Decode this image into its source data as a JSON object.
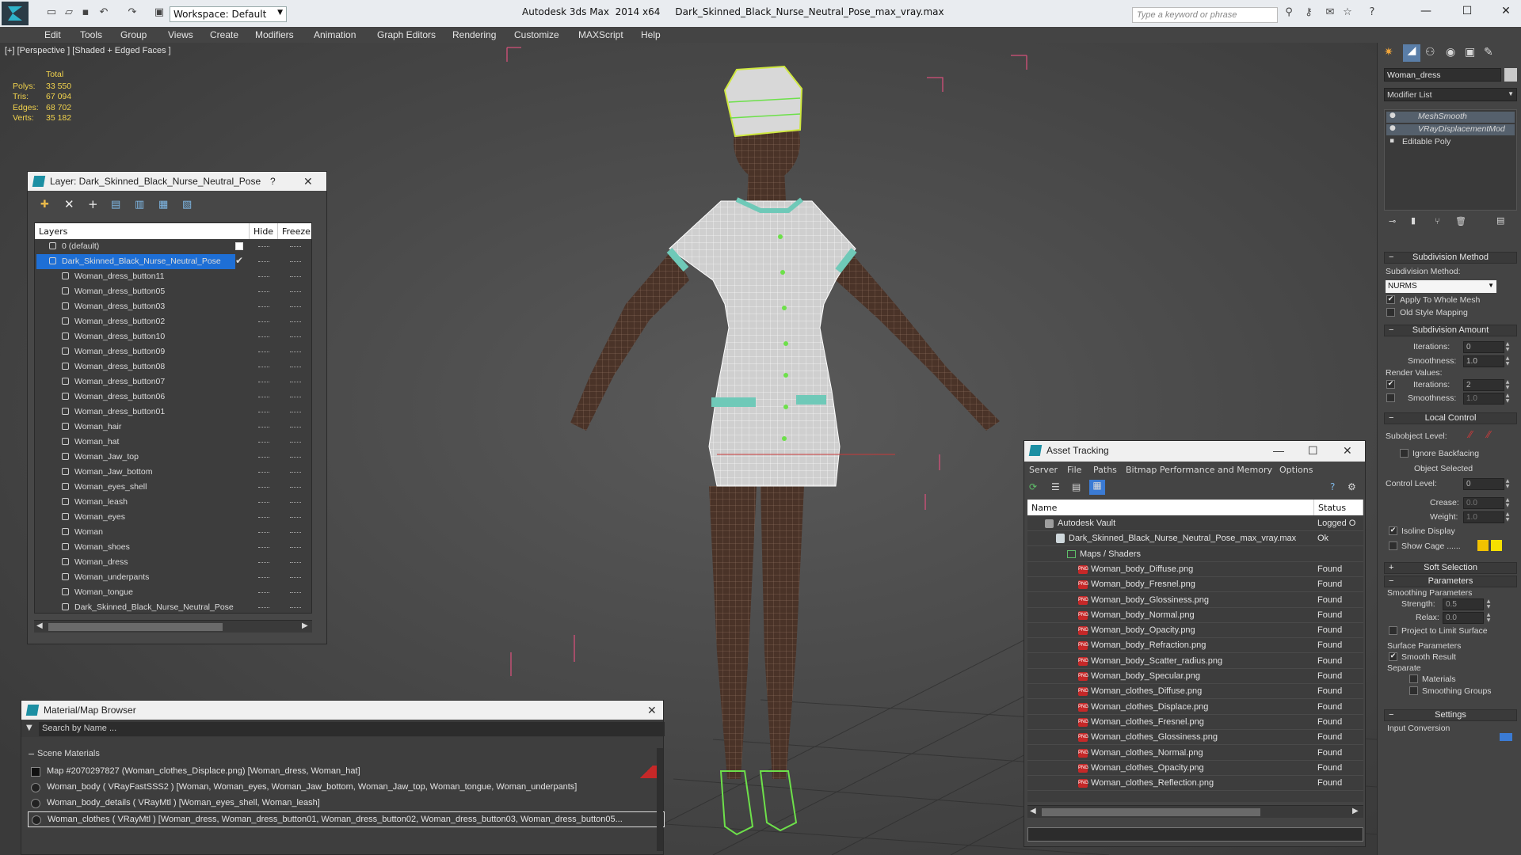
{
  "app": {
    "title": "Autodesk 3ds Max  2014 x64     Dark_Skinned_Black_Nurse_Neutral_Pose_max_vray.max",
    "workspace": "Workspace: Default",
    "search_placeholder": "Type a keyword or phrase"
  },
  "menu": [
    "Edit",
    "Tools",
    "Group",
    "Views",
    "Create",
    "Modifiers",
    "Animation",
    "Graph Editors",
    "Rendering",
    "Customize",
    "MAXScript",
    "Help"
  ],
  "viewport": {
    "label": "[+] [Perspective ] [Shaded + Edged Faces ]",
    "stats": {
      "total_label": "Total",
      "rows": [
        {
          "label": "Polys:",
          "value": "33 550"
        },
        {
          "label": "Tris:",
          "value": "67 094"
        },
        {
          "label": "Edges:",
          "value": "68 702"
        },
        {
          "label": "Verts:",
          "value": "35 182"
        }
      ]
    }
  },
  "layer_explorer": {
    "title": "Layer: Dark_Skinned_Black_Nurse_Neutral_Pose",
    "help": "?",
    "columns": {
      "layers": "Layers",
      "hide": "Hide",
      "freeze": "Freeze"
    },
    "rows": [
      {
        "name": "0 (default)",
        "level": 0,
        "selected": false
      },
      {
        "name": "Dark_Skinned_Black_Nurse_Neutral_Pose",
        "level": 0,
        "selected": true
      },
      {
        "name": "Woman_dress_button11",
        "level": 1,
        "selected": false
      },
      {
        "name": "Woman_dress_button05",
        "level": 1,
        "selected": false
      },
      {
        "name": "Woman_dress_button03",
        "level": 1,
        "selected": false
      },
      {
        "name": "Woman_dress_button02",
        "level": 1,
        "selected": false
      },
      {
        "name": "Woman_dress_button10",
        "level": 1,
        "selected": false
      },
      {
        "name": "Woman_dress_button09",
        "level": 1,
        "selected": false
      },
      {
        "name": "Woman_dress_button08",
        "level": 1,
        "selected": false
      },
      {
        "name": "Woman_dress_button07",
        "level": 1,
        "selected": false
      },
      {
        "name": "Woman_dress_button06",
        "level": 1,
        "selected": false
      },
      {
        "name": "Woman_dress_button01",
        "level": 1,
        "selected": false
      },
      {
        "name": "Woman_hair",
        "level": 1,
        "selected": false
      },
      {
        "name": "Woman_hat",
        "level": 1,
        "selected": false
      },
      {
        "name": "Woman_Jaw_top",
        "level": 1,
        "selected": false
      },
      {
        "name": "Woman_Jaw_bottom",
        "level": 1,
        "selected": false
      },
      {
        "name": "Woman_eyes_shell",
        "level": 1,
        "selected": false
      },
      {
        "name": "Woman_leash",
        "level": 1,
        "selected": false
      },
      {
        "name": "Woman_eyes",
        "level": 1,
        "selected": false
      },
      {
        "name": "Woman",
        "level": 1,
        "selected": false
      },
      {
        "name": "Woman_shoes",
        "level": 1,
        "selected": false
      },
      {
        "name": "Woman_dress",
        "level": 1,
        "selected": false
      },
      {
        "name": "Woman_underpants",
        "level": 1,
        "selected": false
      },
      {
        "name": "Woman_tongue",
        "level": 1,
        "selected": false
      },
      {
        "name": "Dark_Skinned_Black_Nurse_Neutral_Pose",
        "level": 1,
        "selected": false
      }
    ]
  },
  "material_browser": {
    "title": "Material/Map Browser",
    "search_placeholder": "Search by Name ...",
    "group": "Scene Materials",
    "rows": [
      "Map #2070297827 (Woman_clothes_Displace.png)  [Woman_dress, Woman_hat]",
      "Woman_body  ( VRayFastSSS2 ) [Woman, Woman_eyes, Woman_Jaw_bottom, Woman_Jaw_top, Woman_tongue, Woman_underpants]",
      "Woman_body_details  ( VRayMtl ) [Woman_eyes_shell, Woman_leash]",
      "Woman_clothes  ( VRayMtl ) [Woman_dress, Woman_dress_button01, Woman_dress_button02, Woman_dress_button03, Woman_dress_button05..."
    ]
  },
  "asset_tracking": {
    "title": "Asset Tracking",
    "menu": [
      "Server",
      "File",
      "Paths",
      "Bitmap Performance and Memory",
      "Options"
    ],
    "columns": {
      "name": "Name",
      "status": "Status"
    },
    "rows": [
      {
        "name": "Autodesk Vault",
        "status": "Logged O",
        "level": 0,
        "kind": "vault"
      },
      {
        "name": "Dark_Skinned_Black_Nurse_Neutral_Pose_max_vray.max",
        "status": "Ok",
        "level": 1,
        "kind": "max"
      },
      {
        "name": "Maps / Shaders",
        "status": "",
        "level": 2,
        "kind": "folder"
      },
      {
        "name": "Woman_body_Diffuse.png",
        "status": "Found",
        "level": 3,
        "kind": "png"
      },
      {
        "name": "Woman_body_Fresnel.png",
        "status": "Found",
        "level": 3,
        "kind": "png"
      },
      {
        "name": "Woman_body_Glossiness.png",
        "status": "Found",
        "level": 3,
        "kind": "png"
      },
      {
        "name": "Woman_body_Normal.png",
        "status": "Found",
        "level": 3,
        "kind": "png"
      },
      {
        "name": "Woman_body_Opacity.png",
        "status": "Found",
        "level": 3,
        "kind": "png"
      },
      {
        "name": "Woman_body_Refraction.png",
        "status": "Found",
        "level": 3,
        "kind": "png"
      },
      {
        "name": "Woman_body_Scatter_radius.png",
        "status": "Found",
        "level": 3,
        "kind": "png"
      },
      {
        "name": "Woman_body_Specular.png",
        "status": "Found",
        "level": 3,
        "kind": "png"
      },
      {
        "name": "Woman_clothes_Diffuse.png",
        "status": "Found",
        "level": 3,
        "kind": "png"
      },
      {
        "name": "Woman_clothes_Displace.png",
        "status": "Found",
        "level": 3,
        "kind": "png"
      },
      {
        "name": "Woman_clothes_Fresnel.png",
        "status": "Found",
        "level": 3,
        "kind": "png"
      },
      {
        "name": "Woman_clothes_Glossiness.png",
        "status": "Found",
        "level": 3,
        "kind": "png"
      },
      {
        "name": "Woman_clothes_Normal.png",
        "status": "Found",
        "level": 3,
        "kind": "png"
      },
      {
        "name": "Woman_clothes_Opacity.png",
        "status": "Found",
        "level": 3,
        "kind": "png"
      },
      {
        "name": "Woman_clothes_Reflection.png",
        "status": "Found",
        "level": 3,
        "kind": "png"
      }
    ]
  },
  "command_panel": {
    "object_name": "Woman_dress",
    "modifier_list": "Modifier List",
    "stack": [
      "MeshSmooth",
      "VRayDisplacementMod",
      "Editable Poly"
    ],
    "subdivision_method": {
      "header": "Subdivision Method",
      "label": "Subdivision Method:",
      "value": "NURMS",
      "apply_whole_mesh": "Apply To Whole Mesh",
      "old_style_mapping": "Old Style Mapping"
    },
    "subdivision_amount": {
      "header": "Subdivision Amount",
      "iterations_label": "Iterations:",
      "iterations": "0",
      "smoothness_label": "Smoothness:",
      "smoothness": "1.0",
      "render_values": "Render Values:",
      "render_iterations": "2",
      "render_smoothness": "1.0"
    },
    "local_control": {
      "header": "Local Control",
      "subobject_level": "Subobject Level:",
      "ignore_backfacing": "Ignore Backfacing",
      "object_selected": "Object Selected",
      "control_level": "Control Level:",
      "control_level_value": "0",
      "crease": "Crease:",
      "crease_value": "0.0",
      "weight": "Weight:",
      "weight_value": "1.0",
      "isoline_display": "Isoline Display",
      "show_cage": "Show Cage ......"
    },
    "soft_selection": "Soft Selection",
    "parameters": {
      "header": "Parameters",
      "smoothing_parameters": "Smoothing Parameters",
      "strength": "Strength:",
      "strength_value": "0.5",
      "relax": "Relax:",
      "relax_value": "0.0",
      "project_to_limit": "Project to Limit Surface",
      "surface_parameters": "Surface Parameters",
      "smooth_result": "Smooth Result",
      "separate": "Separate",
      "materials": "Materials",
      "smoothing_groups": "Smoothing Groups"
    },
    "settings": {
      "header": "Settings",
      "input_conversion": "Input Conversion"
    }
  },
  "colors": {
    "selection": "#1e6fd6",
    "grid_pink": "#d4507a",
    "stats_yellow": "#f2d34d",
    "wire_green": "#6de04a"
  }
}
